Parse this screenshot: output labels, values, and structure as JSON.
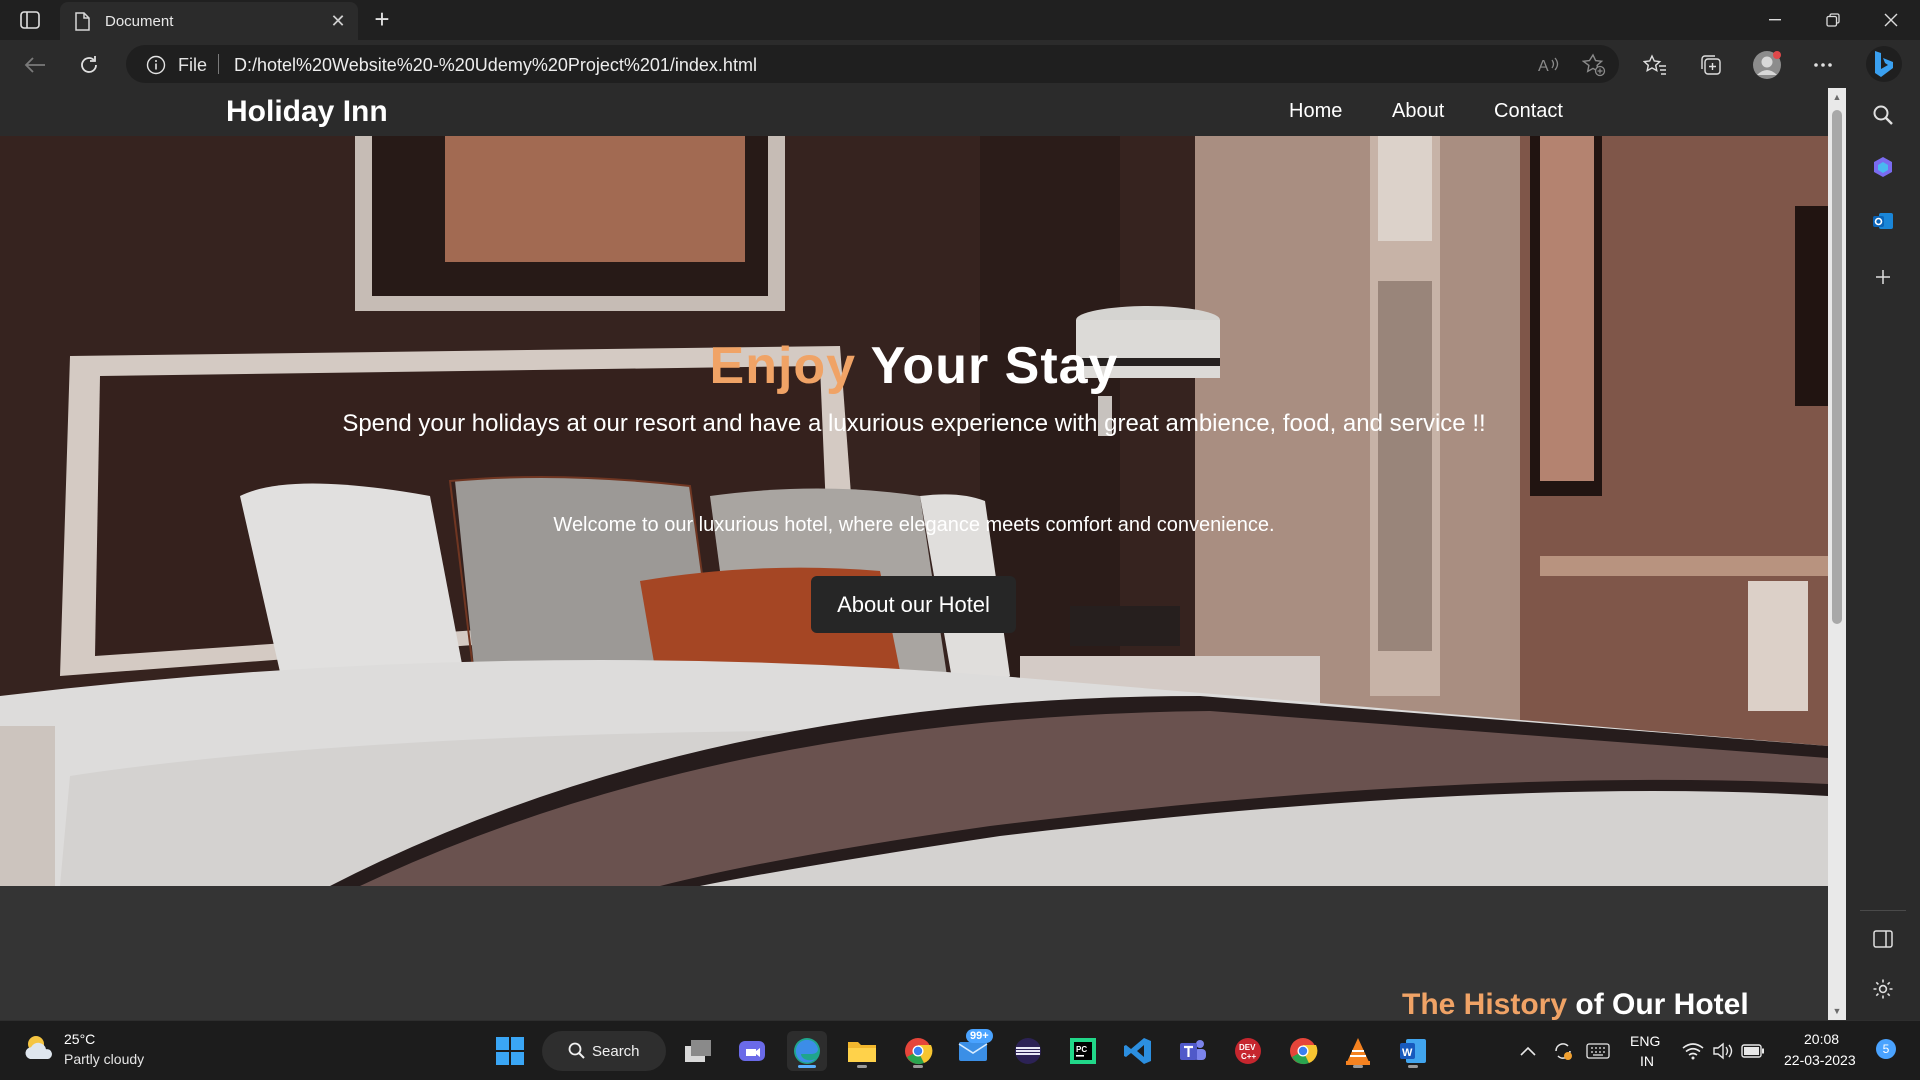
{
  "browser": {
    "tab_title": "Document",
    "url_scheme": "File",
    "url": "D:/hotel%20Website%20-%20Udemy%20Project%201/index.html"
  },
  "site": {
    "brand": "Holiday Inn",
    "nav": [
      "Home",
      "About",
      "Contact"
    ],
    "hero": {
      "title_accent": "Enjoy",
      "title_rest": " Your Stay",
      "subtitle": "Spend your holidays at our resort and have a luxurious experience with great ambience, food, and service !!",
      "welcome": "Welcome to our luxurious hotel, where elegance meets comfort and convenience.",
      "button": "About our Hotel"
    },
    "history": {
      "title_accent": "The History",
      "title_rest": " of Our Hotel"
    }
  },
  "taskbar": {
    "weather_temp": "25°C",
    "weather_cond": "Partly cloudy",
    "search_label": "Search",
    "mail_badge": "99+",
    "lang_top": "ENG",
    "lang_bottom": "IN",
    "time": "20:08",
    "date": "22-03-2023",
    "notification_count": "5"
  },
  "colors": {
    "accent": "#f0a366",
    "nav_bg": "#2b2b2b",
    "button_bg": "#262626"
  }
}
